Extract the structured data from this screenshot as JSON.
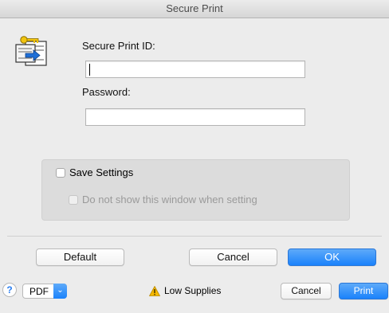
{
  "window": {
    "title": "Secure Print"
  },
  "form": {
    "id_label": "Secure Print ID:",
    "id_value": "",
    "password_label": "Password:",
    "password_value": ""
  },
  "options": {
    "save_settings_label": "Save Settings",
    "save_settings_checked": false,
    "do_not_show_label": "Do not show this window when setting",
    "do_not_show_checked": false,
    "do_not_show_enabled": false
  },
  "dialog_buttons": {
    "default": "Default",
    "cancel": "Cancel",
    "ok": "OK"
  },
  "footer": {
    "help": "?",
    "pdf": "PDF",
    "pdf_arrow": "⌄",
    "status": "Low Supplies",
    "cancel": "Cancel",
    "print": "Print"
  },
  "colors": {
    "accent": "#1a82fb",
    "warning": "#f5b800",
    "background": "#ececec"
  },
  "icons": {
    "app": "secure-print-key-document-icon",
    "warning": "warning-triangle-icon",
    "pdf_menu": "chevron-down-icon"
  }
}
